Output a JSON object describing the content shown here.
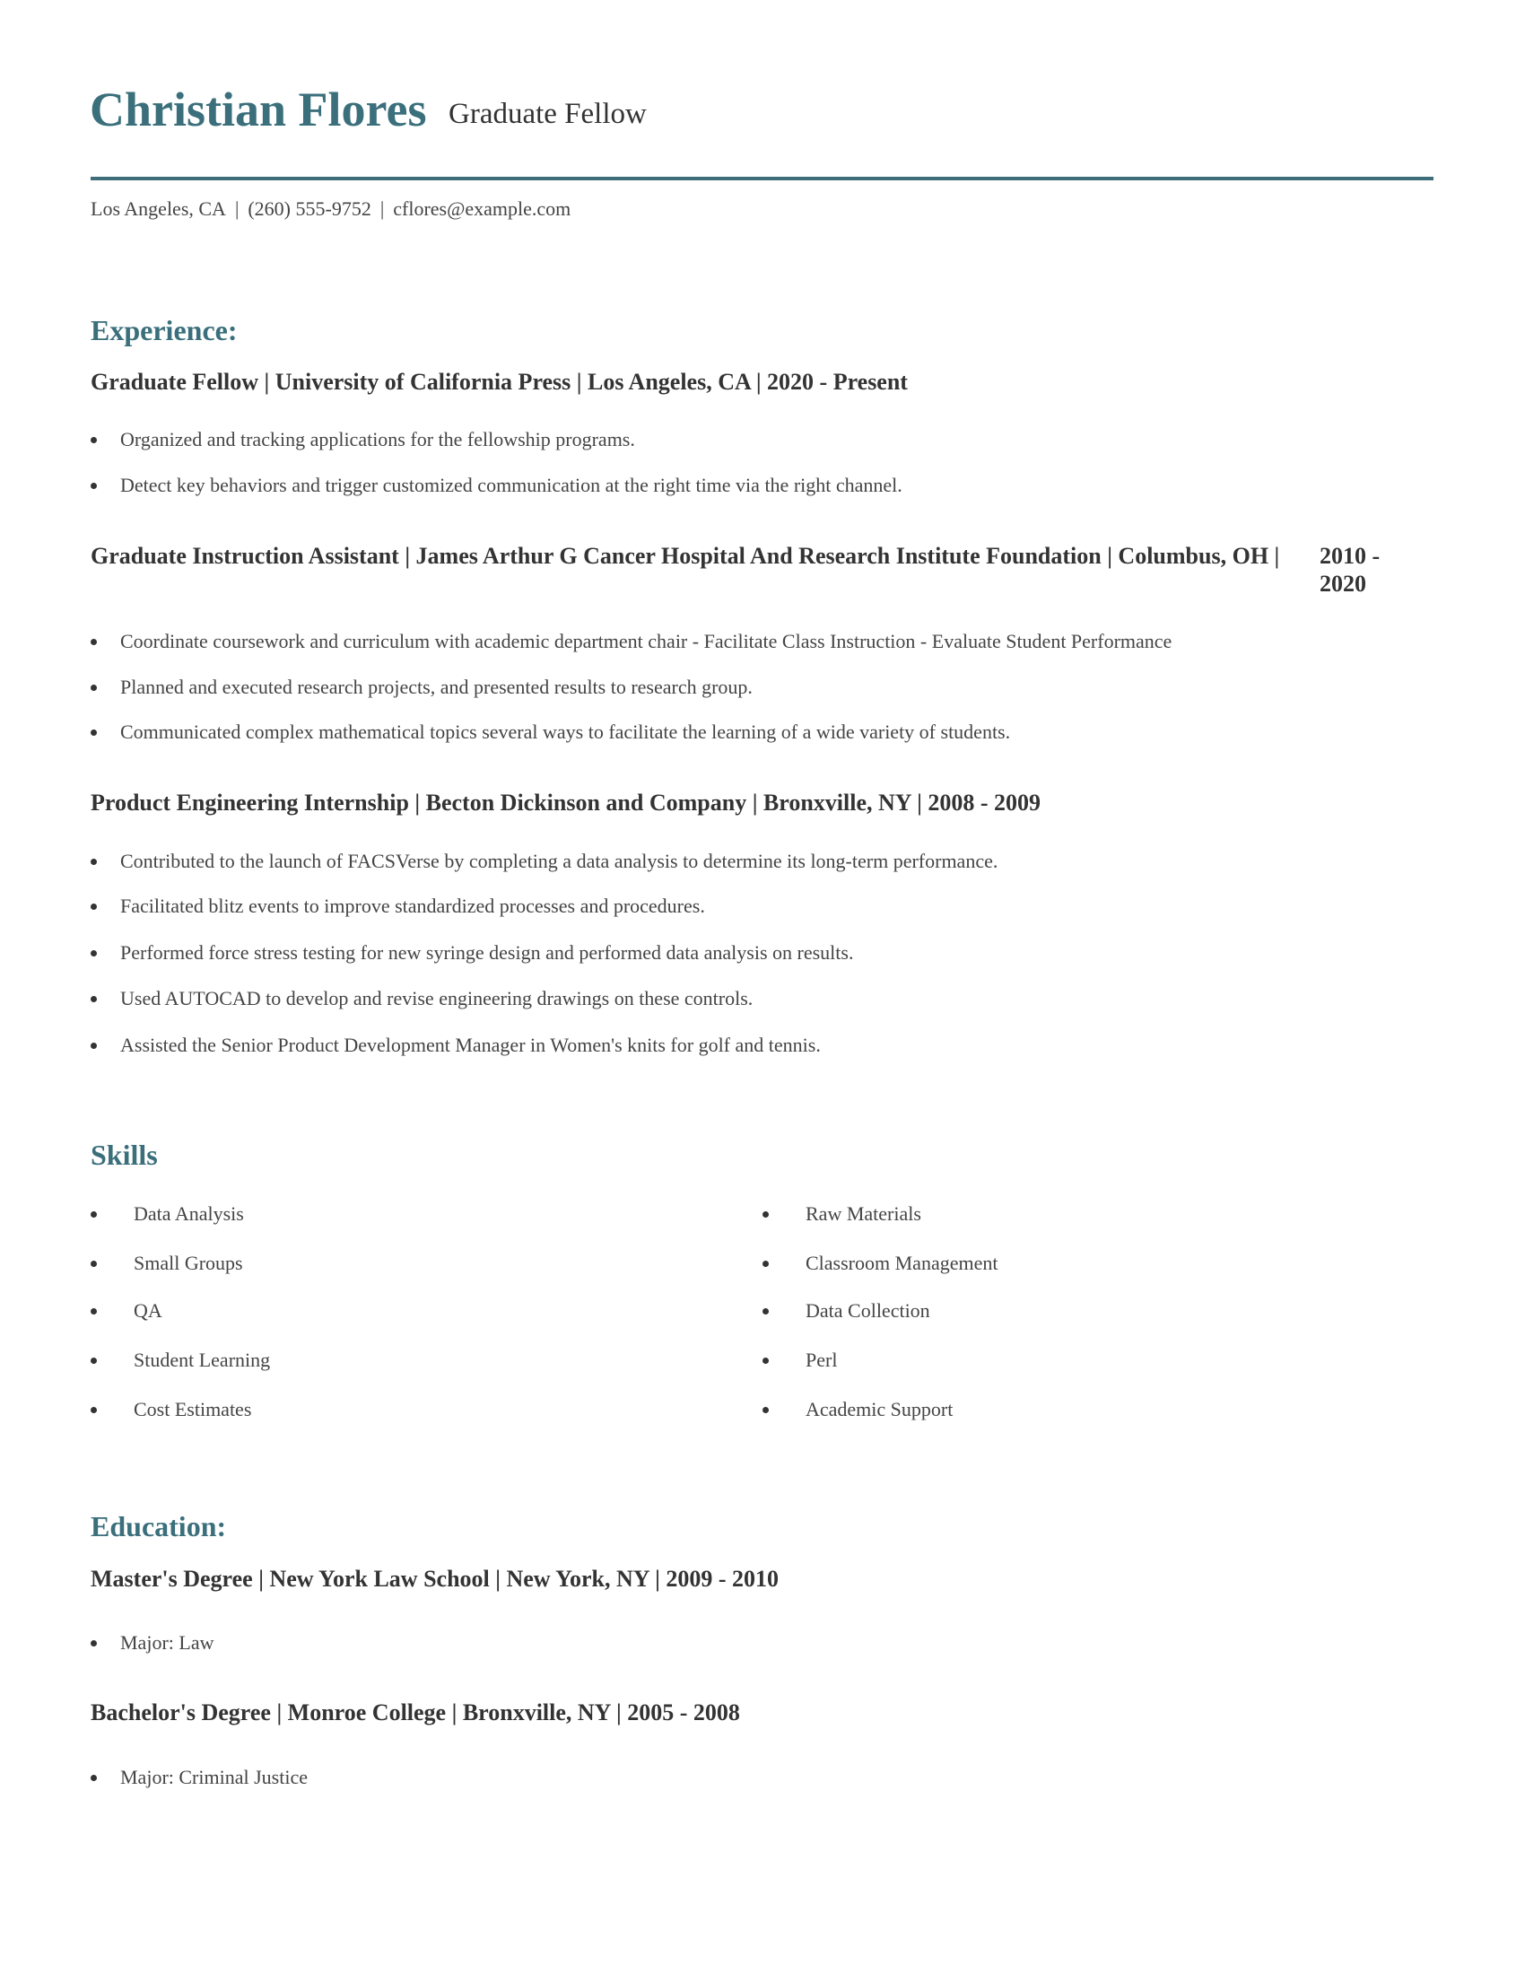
{
  "header": {
    "name": "Christian Flores",
    "title": "Graduate Fellow",
    "contact": {
      "location": "Los Angeles, CA",
      "phone": "(260) 555-9752",
      "email": "cflores@example.com",
      "separator": "|"
    },
    "accent_color": "#3a6f7b"
  },
  "experience": {
    "heading": "Experience:",
    "jobs": [
      {
        "title": "Graduate Fellow | University of California Press | Los Angeles, CA |  2020 - Present",
        "date": "",
        "bullets": [
          "Organized and tracking applications for the fellowship programs.",
          "Detect key behaviors and trigger customized communication at the right time via the right channel."
        ]
      },
      {
        "title": "Graduate Instruction Assistant | James Arthur G Cancer Hospital And Research Institute Foundation | Columbus, OH |",
        "date": "2010 - 2020",
        "bullets": [
          "Coordinate coursework and curriculum with academic department chair - Facilitate Class Instruction - Evaluate Student Performance",
          "Planned and executed research projects, and presented results to research group.",
          "Communicated complex mathematical topics several ways to facilitate the learning of a wide variety of students."
        ]
      },
      {
        "title": "Product Engineering Internship | Becton Dickinson and Company | Bronxville, NY |  2008 - 2009",
        "date": "",
        "bullets": [
          "Contributed to the launch of FACSVerse by completing a data analysis to determine its long-term performance.",
          "Facilitated blitz events to improve standardized processes and procedures.",
          "Performed force stress testing for new syringe design and performed data analysis on results.",
          "Used AUTOCAD to develop and revise engineering drawings on these controls.",
          "Assisted the Senior Product Development Manager in Women's knits for golf and tennis."
        ]
      }
    ]
  },
  "skills": {
    "heading": "Skills",
    "left": [
      "Data Analysis",
      "Small Groups",
      "QA",
      "Student Learning",
      "Cost Estimates"
    ],
    "right": [
      "Raw Materials",
      "Classroom Management",
      "Data Collection",
      "Perl",
      "Academic Support"
    ]
  },
  "education": {
    "heading": "Education:",
    "entries": [
      {
        "title": "Master's Degree | New York Law School | New York, NY |  2009 - 2010",
        "bullets": [
          "Major: Law"
        ]
      },
      {
        "title": "Bachelor's Degree | Monroe College | Bronxville, NY |  2005 - 2008",
        "bullets": [
          "Major: Criminal Justice"
        ]
      }
    ]
  }
}
